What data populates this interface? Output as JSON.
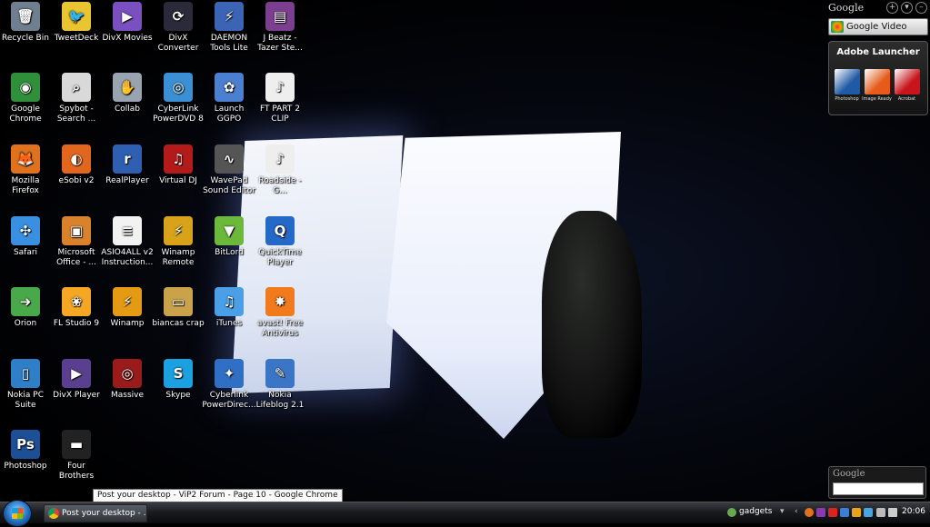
{
  "desktop_icons": [
    {
      "label": "Recycle Bin",
      "icon": "recycle-bin-icon",
      "color": "#6f7f8f",
      "glyph": "🗑"
    },
    {
      "label": "TweetDeck",
      "icon": "tweetdeck-icon",
      "color": "#e8c531",
      "glyph": "🐦"
    },
    {
      "label": "DivX Movies",
      "icon": "divx-movies-icon",
      "color": "#7a4fc0",
      "glyph": "▶"
    },
    {
      "label": "DivX Converter",
      "icon": "divx-converter-icon",
      "color": "#2a2a3a",
      "glyph": "⟳"
    },
    {
      "label": "DAEMON Tools Lite",
      "icon": "daemon-tools-icon",
      "color": "#3b64b5",
      "glyph": "⚡"
    },
    {
      "label": "J Beatz - Tazer Ste...",
      "icon": "winrar-archive-icon",
      "color": "#7c3e8e",
      "glyph": "▤"
    },
    {
      "label": "Google Chrome",
      "icon": "chrome-icon",
      "color": "#2f8f3a",
      "glyph": "◉"
    },
    {
      "label": "Spybot - Search ...",
      "icon": "spybot-icon",
      "color": "#d9d9d9",
      "glyph": "⌕"
    },
    {
      "label": "Collab",
      "icon": "collab-icon",
      "color": "#9aa4b0",
      "glyph": "✋"
    },
    {
      "label": "CyberLink PowerDVD 8",
      "icon": "powerdvd-icon",
      "color": "#3b8fd4",
      "glyph": "◎"
    },
    {
      "label": "Launch GGPO",
      "icon": "ggpo-icon",
      "color": "#4b7fcf",
      "glyph": "✿"
    },
    {
      "label": "FT PART 2 CLIP",
      "icon": "mp3-file-icon",
      "color": "#eeeeee",
      "glyph": "♪"
    },
    {
      "label": "Mozilla Firefox",
      "icon": "firefox-icon",
      "color": "#e0721e",
      "glyph": "🦊"
    },
    {
      "label": "eSobi v2",
      "icon": "esobi-icon",
      "color": "#e2661e",
      "glyph": "◐"
    },
    {
      "label": "RealPlayer",
      "icon": "realplayer-icon",
      "color": "#2e5fb0",
      "glyph": "r"
    },
    {
      "label": "Virtual DJ",
      "icon": "virtual-dj-icon",
      "color": "#b31b1b",
      "glyph": "♫"
    },
    {
      "label": "WavePad Sound Editor",
      "icon": "wavepad-icon",
      "color": "#555555",
      "glyph": "∿"
    },
    {
      "label": "Roadside - G...",
      "icon": "mp3-file-icon",
      "color": "#eeeeee",
      "glyph": "♪"
    },
    {
      "label": "Safari",
      "icon": "safari-icon",
      "color": "#3a8fe0",
      "glyph": "✣"
    },
    {
      "label": "Microsoft Office - ...",
      "icon": "ms-office-icon",
      "color": "#d9822b",
      "glyph": "▣"
    },
    {
      "label": "ASIO4ALL v2 Instruction...",
      "icon": "document-icon",
      "color": "#f2f2f2",
      "glyph": "≡"
    },
    {
      "label": "Winamp Remote",
      "icon": "winamp-remote-icon",
      "color": "#d8a31a",
      "glyph": "⚡"
    },
    {
      "label": "BitLord",
      "icon": "bitlord-icon",
      "color": "#6bb83a",
      "glyph": "▼"
    },
    {
      "label": "QuickTime Player",
      "icon": "quicktime-icon",
      "color": "#2468c8",
      "glyph": "Q"
    },
    {
      "label": "Orion",
      "icon": "orion-icon",
      "color": "#49a84a",
      "glyph": "➜"
    },
    {
      "label": "FL Studio 9",
      "icon": "fl-studio-icon",
      "color": "#f5a623",
      "glyph": "❀"
    },
    {
      "label": "Winamp",
      "icon": "winamp-icon",
      "color": "#e59a13",
      "glyph": "⚡"
    },
    {
      "label": "biancas crap",
      "icon": "folder-icon",
      "color": "#c9a24a",
      "glyph": "▭"
    },
    {
      "label": "iTunes",
      "icon": "itunes-icon",
      "color": "#4a9fe6",
      "glyph": "♫"
    },
    {
      "label": "avast! Free Antivirus",
      "icon": "avast-icon",
      "color": "#f07a1c",
      "glyph": "✸"
    },
    {
      "label": "Nokia PC Suite",
      "icon": "nokia-pc-suite-icon",
      "color": "#2e7fc7",
      "glyph": "▯"
    },
    {
      "label": "DivX Player",
      "icon": "divx-player-icon",
      "color": "#5a3f91",
      "glyph": "▶"
    },
    {
      "label": "Massive",
      "icon": "massive-icon",
      "color": "#9a1b1b",
      "glyph": "◎"
    },
    {
      "label": "Skype",
      "icon": "skype-icon",
      "color": "#1ba0e2",
      "glyph": "S"
    },
    {
      "label": "Cyberlink PowerDirec...",
      "icon": "powerdirector-icon",
      "color": "#2f6fc4",
      "glyph": "✦"
    },
    {
      "label": "Nokia Lifeblog 2.1",
      "icon": "nokia-lifeblog-icon",
      "color": "#3b76c6",
      "glyph": "✎"
    },
    {
      "label": "Photoshop",
      "icon": "photoshop-icon",
      "color": "#1d4f96",
      "glyph": "Ps"
    },
    {
      "label": "Four Brothers",
      "icon": "video-file-icon",
      "color": "#222222",
      "glyph": "▬"
    }
  ],
  "sidebar": {
    "google_logo": "Google",
    "controls": [
      "+",
      "▾",
      "–"
    ],
    "google_video_label": "Google Video",
    "adobe_title": "Adobe Launcher",
    "adobe_apps": [
      {
        "label": "Photoshop",
        "icon": "photoshop-feather-icon",
        "color": "#1f5aa6"
      },
      {
        "label": "Image Ready",
        "icon": "imageready-icon",
        "color": "#e65b1a"
      },
      {
        "label": "Acrobat",
        "icon": "acrobat-icon",
        "color": "#c8141a"
      }
    ],
    "search_logo": "Google"
  },
  "tooltip": "Post your desktop - ViP2 Forum - Page 10 - Google Chrome",
  "taskbar": {
    "window_button": "Post your desktop - ...",
    "tray_toolbar": "gadgets",
    "clock": "20:06"
  }
}
